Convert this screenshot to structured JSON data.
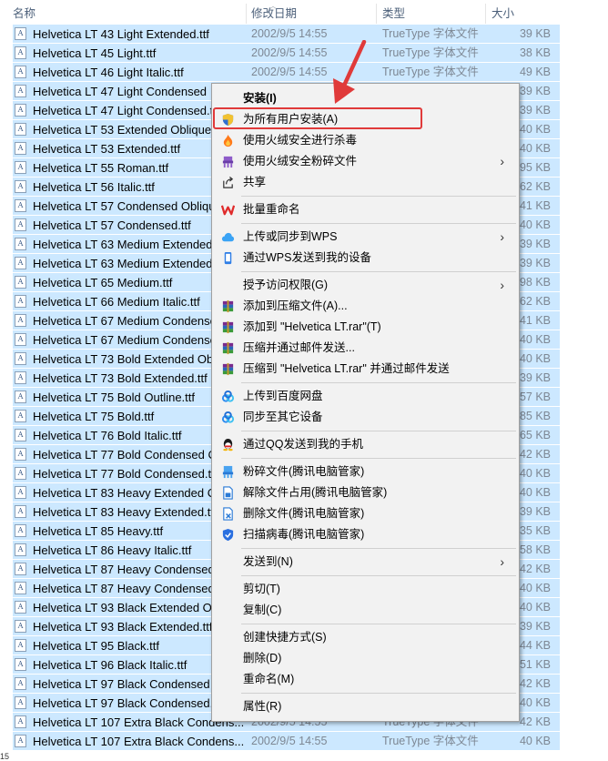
{
  "columns": {
    "name": "名称",
    "date": "修改日期",
    "type": "类型",
    "size": "大小"
  },
  "files": [
    {
      "name": "Helvetica LT 43 Light Extended.ttf",
      "date": "2002/9/5 14:55",
      "type": "TrueType 字体文件",
      "size": "39 KB"
    },
    {
      "name": "Helvetica LT 45 Light.ttf",
      "date": "2002/9/5 14:55",
      "type": "TrueType 字体文件",
      "size": "38 KB"
    },
    {
      "name": "Helvetica LT 46 Light Italic.ttf",
      "date": "2002/9/5 14:55",
      "type": "TrueType 字体文件",
      "size": "49 KB"
    },
    {
      "name": "Helvetica LT 47 Light Condensed",
      "size": "39 KB"
    },
    {
      "name": "Helvetica LT 47 Light Condensed.t",
      "size": "39 KB"
    },
    {
      "name": "Helvetica LT 53 Extended Oblique",
      "size": "40 KB"
    },
    {
      "name": "Helvetica LT 53 Extended.ttf",
      "size": "40 KB"
    },
    {
      "name": "Helvetica LT 55 Roman.ttf",
      "size": "95 KB"
    },
    {
      "name": "Helvetica LT 56 Italic.ttf",
      "size": "62 KB"
    },
    {
      "name": "Helvetica LT 57 Condensed Obliqu",
      "size": "41 KB"
    },
    {
      "name": "Helvetica LT 57 Condensed.ttf",
      "size": "40 KB"
    },
    {
      "name": "Helvetica LT 63 Medium Extended",
      "size": "39 KB"
    },
    {
      "name": "Helvetica LT 63 Medium Extended",
      "size": "39 KB"
    },
    {
      "name": "Helvetica LT 65 Medium.ttf",
      "size": "98 KB"
    },
    {
      "name": "Helvetica LT 66 Medium Italic.ttf",
      "size": "62 KB"
    },
    {
      "name": "Helvetica LT 67 Medium Condense",
      "size": "41 KB"
    },
    {
      "name": "Helvetica LT 67 Medium Condense",
      "size": "40 KB"
    },
    {
      "name": "Helvetica LT 73 Bold Extended Ob",
      "size": "40 KB"
    },
    {
      "name": "Helvetica LT 73 Bold Extended.ttf",
      "size": "39 KB"
    },
    {
      "name": "Helvetica LT 75 Bold Outline.ttf",
      "size": "57 KB"
    },
    {
      "name": "Helvetica LT 75 Bold.ttf",
      "size": "85 KB"
    },
    {
      "name": "Helvetica LT 76 Bold Italic.ttf",
      "size": "65 KB"
    },
    {
      "name": "Helvetica LT 77 Bold Condensed C",
      "size": "42 KB"
    },
    {
      "name": "Helvetica LT 77 Bold Condensed.t",
      "size": "40 KB"
    },
    {
      "name": "Helvetica LT 83 Heavy Extended C",
      "size": "40 KB"
    },
    {
      "name": "Helvetica LT 83 Heavy Extended.tt",
      "size": "39 KB"
    },
    {
      "name": "Helvetica LT 85 Heavy.ttf",
      "size": "35 KB"
    },
    {
      "name": "Helvetica LT 86 Heavy Italic.ttf",
      "size": "58 KB"
    },
    {
      "name": "Helvetica LT 87 Heavy Condensed",
      "size": "42 KB"
    },
    {
      "name": "Helvetica LT 87 Heavy Condensed",
      "size": "40 KB"
    },
    {
      "name": "Helvetica LT 93 Black Extended Ol",
      "size": "40 KB"
    },
    {
      "name": "Helvetica LT 93 Black Extended.ttf",
      "size": "39 KB"
    },
    {
      "name": "Helvetica LT 95 Black.ttf",
      "size": "44 KB"
    },
    {
      "name": "Helvetica LT 96 Black Italic.ttf",
      "size": "51 KB"
    },
    {
      "name": "Helvetica LT 97 Black Condensed",
      "size": "42 KB"
    },
    {
      "name": "Helvetica LT 97 Black Condensed.t",
      "size": "40 KB"
    },
    {
      "name": "Helvetica LT 107 Extra Black Condens...",
      "date": "2002/9/5 14:55",
      "type": "TrueType 字体文件",
      "size": "42 KB"
    },
    {
      "name": "Helvetica LT 107 Extra Black Condens...",
      "date": "2002/9/5 14:55",
      "type": "TrueType 字体文件",
      "size": "40 KB"
    }
  ],
  "context_menu": {
    "install": "安装(I)",
    "install_all_users": "为所有用户安装(A)",
    "huorong_scan": "使用火绒安全进行杀毒",
    "huorong_shred": "使用火绒安全粉碎文件",
    "share": "共享",
    "batch_rename": "批量重命名",
    "wps_upload": "上传或同步到WPS",
    "wps_send": "通过WPS发送到我的设备",
    "grant_access": "授予访问权限(G)",
    "rar_add": "添加到压缩文件(A)...",
    "rar_add_named": "添加到 \"Helvetica LT.rar\"(T)",
    "rar_email": "压缩并通过邮件发送...",
    "rar_named_email": "压缩到 \"Helvetica LT.rar\" 并通过邮件发送",
    "baidu_upload": "上传到百度网盘",
    "baidu_sync": "同步至其它设备",
    "qq_send": "通过QQ发送到我的手机",
    "tencent_shred": "粉碎文件(腾讯电脑管家)",
    "tencent_unlock": "解除文件占用(腾讯电脑管家)",
    "tencent_delete": "删除文件(腾讯电脑管家)",
    "tencent_scan": "扫描病毒(腾讯电脑管家)",
    "send_to": "发送到(N)",
    "cut": "剪切(T)",
    "copy": "复制(C)",
    "create_shortcut": "创建快捷方式(S)",
    "delete": "删除(D)",
    "rename": "重命名(M)",
    "properties": "属性(R)"
  },
  "icons": {
    "file": "font-file-icon",
    "shield": "uac-shield-icon",
    "fire": "huorong-icon",
    "share": "share-icon",
    "wps": "wps-icon",
    "cloud": "cloud-icon",
    "phone": "phone-icon",
    "rar": "winrar-icon",
    "baidu": "baidu-netdisk-icon",
    "qq": "qq-icon",
    "tencent": "tencent-pc-manager-icon"
  },
  "colors": {
    "selection": "#cce8ff",
    "annotation_red": "#e03a3a",
    "menu_bg": "#f2f2f2"
  },
  "footer_mark": "15"
}
